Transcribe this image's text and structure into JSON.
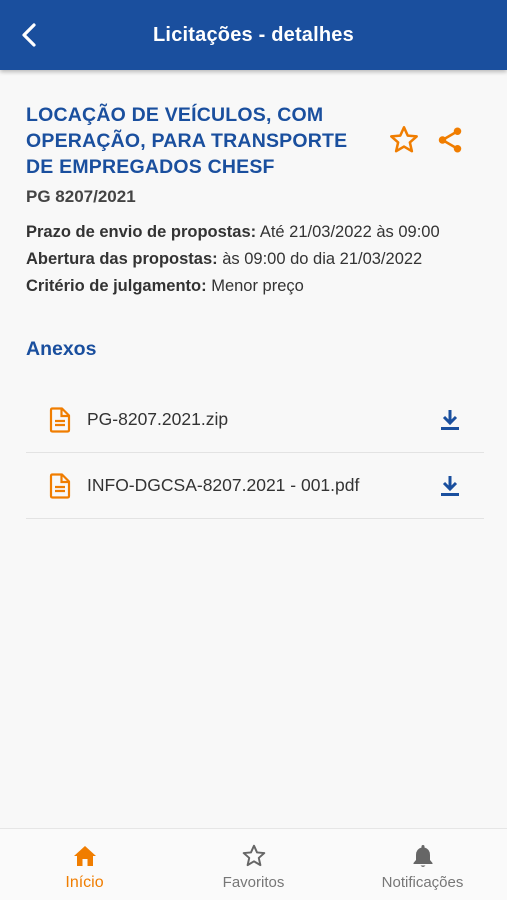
{
  "header": {
    "title": "Licitações - detalhes"
  },
  "tender": {
    "title": "LOCAÇÃO DE VEÍCULOS, COM OPERAÇÃO, PARA TRANSPORTE DE EMPREGADOS CHESF",
    "code": "PG 8207/2021",
    "info": [
      {
        "label": "Prazo de envio de propostas:",
        "value": "Até 21/03/2022 às 09:00"
      },
      {
        "label": "Abertura das propostas:",
        "value": "às 09:00 do dia 21/03/2022"
      },
      {
        "label": "Critério de julgamento:",
        "value": "Menor preço"
      }
    ]
  },
  "attachments": {
    "title": "Anexos",
    "items": [
      {
        "name": "PG-8207.2021.zip"
      },
      {
        "name": "INFO-DGCSA-8207.2021 - 001.pdf"
      }
    ]
  },
  "bottom_nav": {
    "items": [
      {
        "label": "Início",
        "icon": "home-icon",
        "active": true
      },
      {
        "label": "Favoritos",
        "icon": "star-icon",
        "active": false
      },
      {
        "label": "Notificações",
        "icon": "bell-icon",
        "active": false
      }
    ]
  },
  "colors": {
    "primary": "#1a4f9e",
    "accent": "#f07d00"
  },
  "icons": {
    "back": "back-arrow-icon",
    "favorite": "star-outline-icon",
    "share": "share-icon",
    "file": "document-icon",
    "download": "download-icon"
  }
}
